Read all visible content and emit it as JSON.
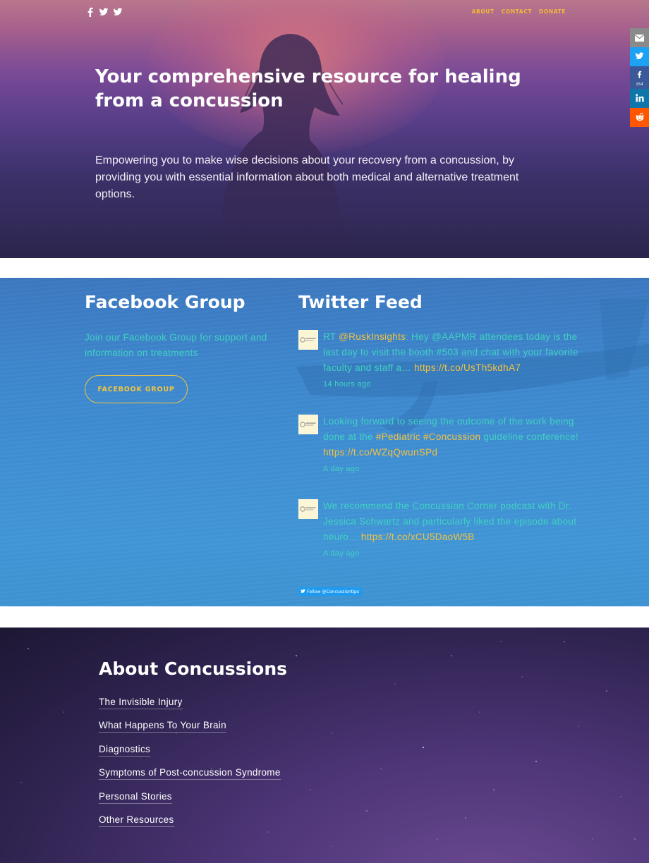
{
  "nav": {
    "links": [
      "ABOUT",
      "CONTACT",
      "DONATE"
    ]
  },
  "social_top": [
    "facebook-icon",
    "twitter-icon",
    "twitter-icon"
  ],
  "hero": {
    "title": "Your comprehensive resource for healing from a concussion",
    "subtitle": "Empowering you to make wise decisions about your recovery from a concussion, by providing you with essential information about both medical and alternative treatment options."
  },
  "share": {
    "items": [
      "email-icon",
      "twitter-icon",
      "facebook-icon",
      "linkedin-icon",
      "reddit-icon"
    ],
    "facebook_count": "154",
    "colors": {
      "email": "#8a8a8a",
      "twitter": "#1da1f2",
      "facebook": "#3b5998",
      "linkedin": "#0e76a8",
      "reddit": "#ff5700"
    }
  },
  "facebook": {
    "title": "Facebook Group",
    "text": "Join our Facebook Group for support and information on treatments",
    "button": "FACEBOOK GROUP"
  },
  "twitter": {
    "title": "Twitter Feed",
    "tweets": [
      {
        "parts": [
          "RT ",
          "@RuskInsights",
          ": Hey @AAPMR attendees today is the last day to visit the booth #503 and chat with your favorite faculty and staff a… ",
          "https://t.co/UsTh5kdhA7"
        ],
        "time": "14 hours ago"
      },
      {
        "parts": [
          "Looking forward to seeing the outcome of the work being done at the ",
          "#Pediatric #Concussion",
          " guideline conference! ",
          "https://t.co/WZqQwunSPd"
        ],
        "time": "A day ago"
      },
      {
        "parts": [
          "We recommend the Concussion Corner podcast with Dr. Jessica Schwartz and particularly liked the episode about neuro… ",
          "https://t.co/xCU5DaoW5B"
        ],
        "time": "A day ago"
      }
    ],
    "follow": "Follow @Concussiontips"
  },
  "about": {
    "title": "About Concussions",
    "links": [
      "The Invisible Injury",
      "What Happens To Your Brain",
      "Diagnostics",
      "Symptoms of Post-concussion Syndrome",
      "Personal Stories",
      "Other Resources"
    ]
  },
  "colors": {
    "accent_yellow": "#f0c53d",
    "teal_text": "#40d0c2"
  }
}
